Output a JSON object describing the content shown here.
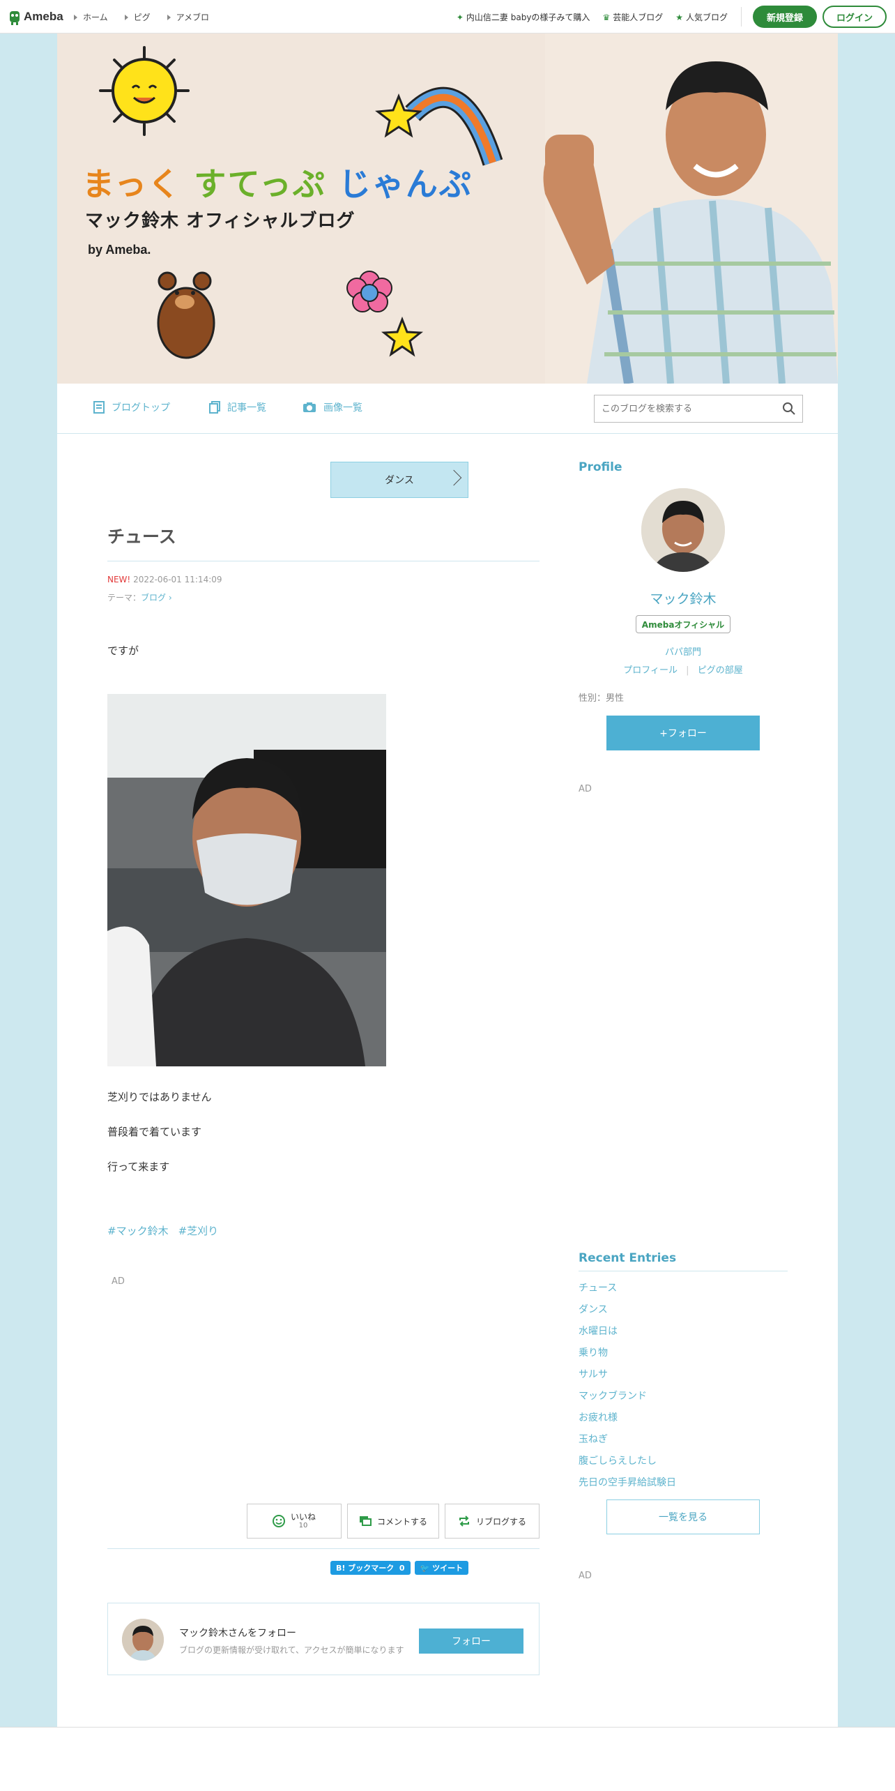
{
  "topbar": {
    "logo": "Ameba",
    "nav": [
      "ホーム",
      "ピグ",
      "アメブロ"
    ],
    "links": [
      "内山信二妻 babyの様子みて購入",
      "芸能人ブログ",
      "人気ブログ"
    ],
    "register": "新規登録",
    "login": "ログイン"
  },
  "banner": {
    "title_part1": "まっく",
    "title_part2": "すてっぷ",
    "title_part3": "じゃんぷ",
    "subtitle": "マック鈴木 オフィシャルブログ",
    "by": "by Ameba."
  },
  "blognav": {
    "items": [
      "ブログトップ",
      "記事一覧",
      "画像一覧"
    ],
    "search_placeholder": "このブログを検索する"
  },
  "article": {
    "theme_button": "ダンス",
    "title": "チュース",
    "new_label": "NEW!",
    "date": "2022-06-01 11:14:09",
    "theme_prefix": "テーマ：",
    "theme_link": "ブログ",
    "paragraphs": [
      "ですが",
      "芝刈りではありません",
      "普段着で着ています",
      "行って来ます"
    ],
    "tags": [
      "#マック鈴木",
      "#芝刈り"
    ],
    "ad": "AD",
    "like_label": "いいね",
    "like_count": "10",
    "comment_label": "コメントする",
    "reblog_label": "リブログする",
    "bookmark_label": "B! ブックマーク",
    "bookmark_count": "0",
    "tweet_label": "ツイート",
    "follow_card_name": "マック鈴木さんをフォロー",
    "follow_card_desc": "ブログの更新情報が受け取れて、アクセスが簡単になります",
    "follow_card_button": "フォロー"
  },
  "sidebar": {
    "profile_heading": "Profile",
    "name": "マック鈴木",
    "badge": "Amebaオフィシャル",
    "category": "パパ部門",
    "link_profile": "プロフィール",
    "link_room": "ピグの部屋",
    "sex": "性別：男性",
    "follow": "+フォロー",
    "ad": "AD",
    "recent_heading": "Recent Entries",
    "recent": [
      "チュース",
      "ダンス",
      "水曜日は",
      "乗り物",
      "サルサ",
      "マックブランド",
      "お疲れ様",
      "玉ねぎ",
      "腹ごしらえしたし",
      "先日の空手昇給試験日"
    ],
    "see_all": "一覧を見る",
    "ad2": "AD"
  }
}
